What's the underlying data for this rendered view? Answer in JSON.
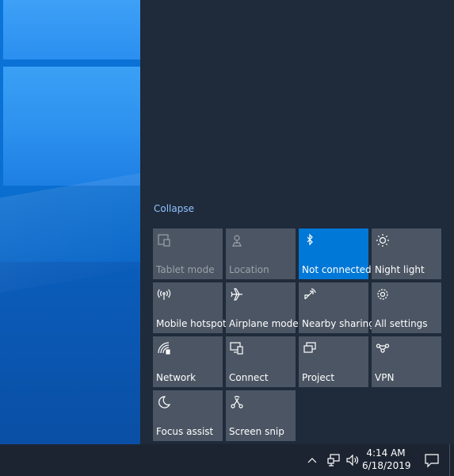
{
  "action_center": {
    "collapse_label": "Collapse",
    "tiles": [
      {
        "label": "Tablet mode",
        "icon": "tablet-mode-icon",
        "state": "disabled"
      },
      {
        "label": "Location",
        "icon": "location-icon",
        "state": "disabled"
      },
      {
        "label": "Not connected",
        "icon": "bluetooth-icon",
        "state": "active"
      },
      {
        "label": "Night light",
        "icon": "night-light-icon",
        "state": "normal"
      },
      {
        "label": "Mobile hotspot",
        "icon": "mobile-hotspot-icon",
        "state": "normal"
      },
      {
        "label": "Airplane mode",
        "icon": "airplane-icon",
        "state": "normal"
      },
      {
        "label": "Nearby sharing",
        "icon": "nearby-sharing-icon",
        "state": "normal"
      },
      {
        "label": "All settings",
        "icon": "gear-icon",
        "state": "normal"
      },
      {
        "label": "Network",
        "icon": "network-icon",
        "state": "normal"
      },
      {
        "label": "Connect",
        "icon": "connect-icon",
        "state": "normal"
      },
      {
        "label": "Project",
        "icon": "project-icon",
        "state": "normal"
      },
      {
        "label": "VPN",
        "icon": "vpn-icon",
        "state": "normal"
      },
      {
        "label": "Focus assist",
        "icon": "moon-icon",
        "state": "normal"
      },
      {
        "label": "Screen snip",
        "icon": "screen-snip-icon",
        "state": "normal"
      }
    ]
  },
  "taskbar": {
    "time": "4:14 AM",
    "date": "6/18/2019",
    "tray_icons": [
      "chevron-up-icon",
      "network-icon",
      "volume-icon"
    ],
    "notification_icon": "action-center-icon"
  },
  "colors": {
    "tile": "#4b5563",
    "tile_active": "#0078d7",
    "panel": "#1f2a3a",
    "taskbar": "#1d2431",
    "link": "#8fc3ff"
  }
}
